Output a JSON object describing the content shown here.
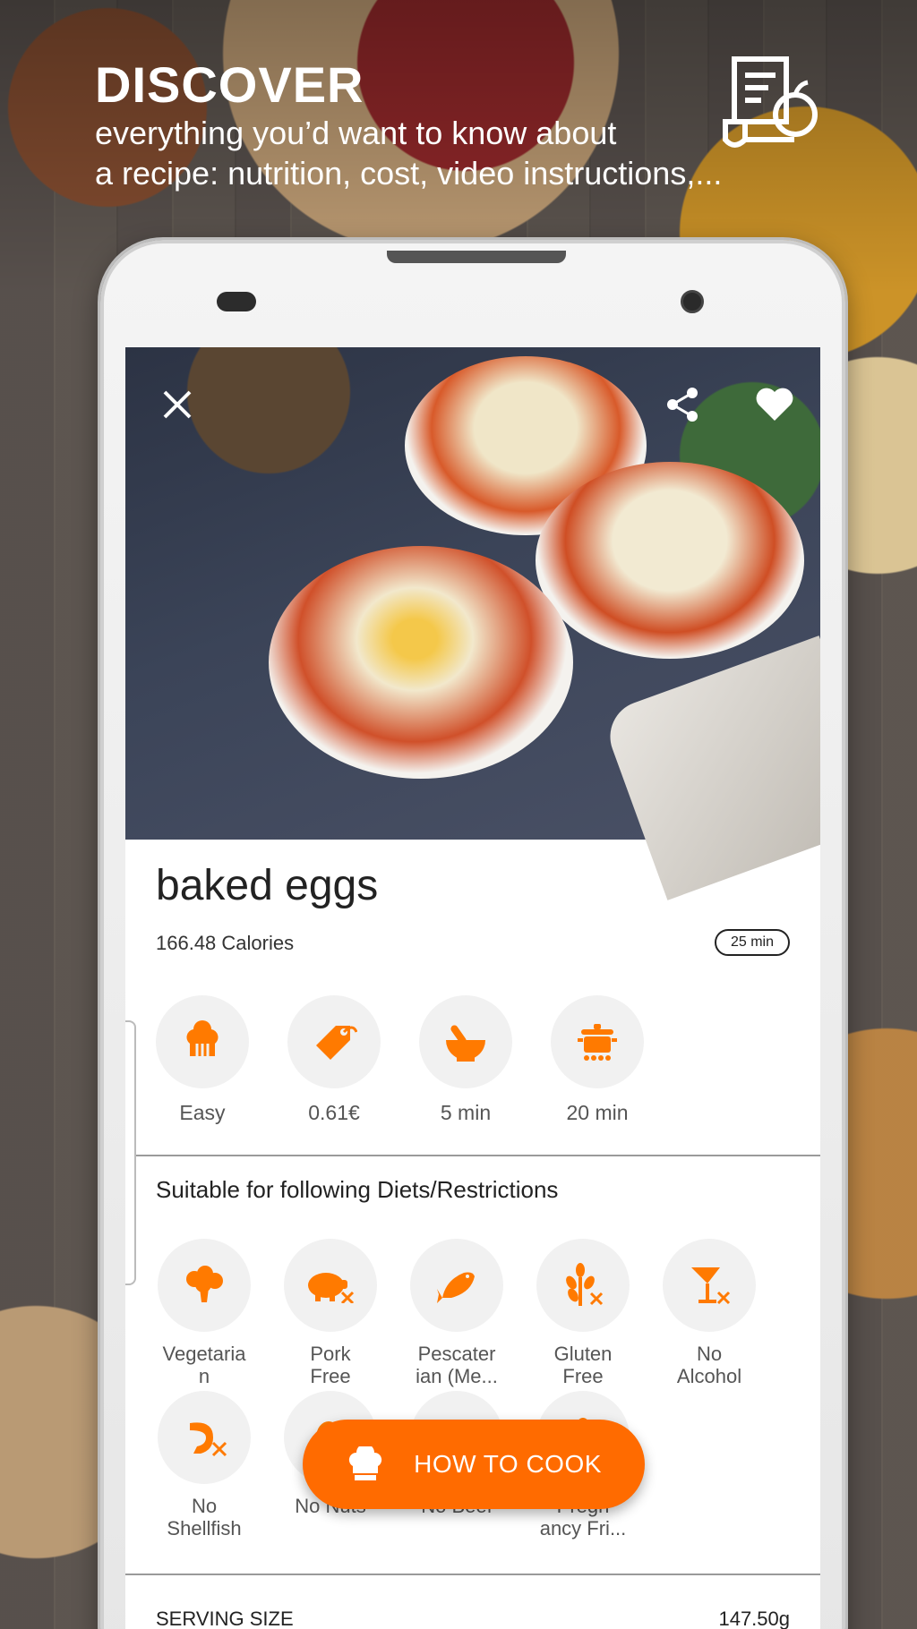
{
  "promo": {
    "title": "DISCOVER",
    "subtitle_line1": "everything you’d want to know about",
    "subtitle_line2": "a recipe: nutrition, cost, video instructions,..."
  },
  "recipe": {
    "name": "baked eggs",
    "calories": "166.48 Calories",
    "total_time": "25 min"
  },
  "stats": [
    {
      "icon": "chef-hat-icon",
      "label": "Easy"
    },
    {
      "icon": "price-tag-icon",
      "label": "0.61€"
    },
    {
      "icon": "mortar-pestle-icon",
      "label": "5 min"
    },
    {
      "icon": "cooking-pot-icon",
      "label": "20 min"
    }
  ],
  "diets": {
    "heading": "Suitable for following Diets/Restrictions",
    "items": [
      {
        "icon": "broccoli-icon",
        "line1": "Vegetaria",
        "line2": "n"
      },
      {
        "icon": "pig-crossed-icon",
        "line1": "Pork",
        "line2": "Free"
      },
      {
        "icon": "fish-icon",
        "line1": "Pescater",
        "line2": "ian (Me..."
      },
      {
        "icon": "wheat-crossed-icon",
        "line1": "Gluten",
        "line2": "Free"
      },
      {
        "icon": "cocktail-crossed-icon",
        "line1": "No",
        "line2": "Alcohol"
      },
      {
        "icon": "shrimp-crossed-icon",
        "line1": "No",
        "line2": "Shellfish"
      },
      {
        "icon": "nut-crossed-icon",
        "line1": "No Nuts",
        "line2": ""
      },
      {
        "icon": "beef-crossed-icon",
        "line1": "No Beef",
        "line2": ""
      },
      {
        "icon": "pregnancy-icon",
        "line1": "Pregn",
        "line2": "ancy Fri..."
      }
    ]
  },
  "cook_button": {
    "label": "HOW TO COOK",
    "icon": "chef-hat-icon"
  },
  "serving": {
    "label": "SERVING SIZE",
    "value": "147.50g"
  },
  "colors": {
    "accent": "#ff6b00",
    "icon_bg": "#f1f1f1"
  }
}
